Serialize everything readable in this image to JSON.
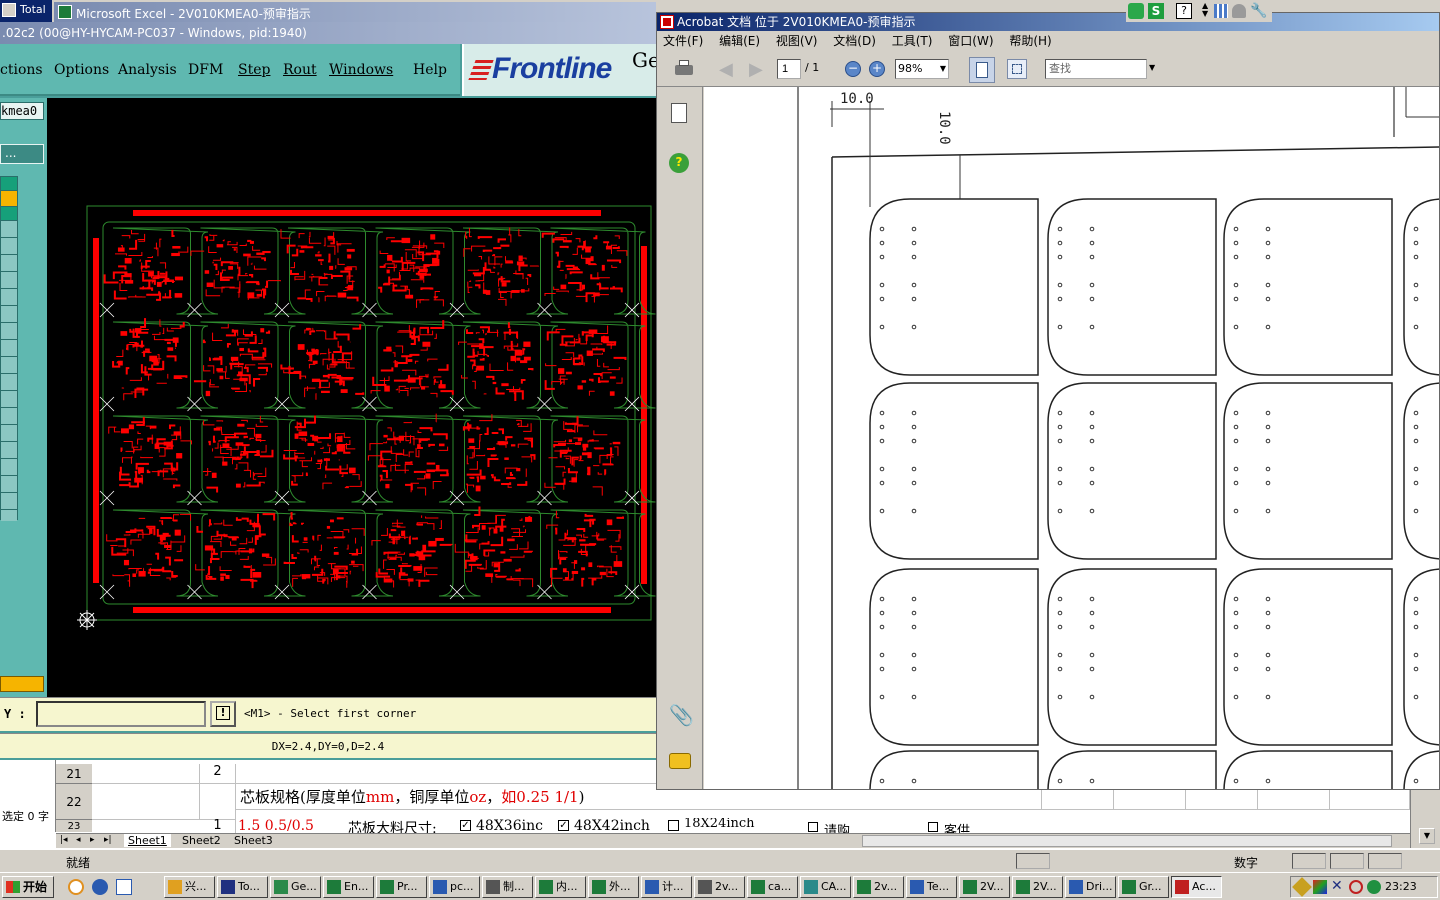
{
  "topbar": {
    "total_label": "Total",
    "excel_title": "Microsoft Excel - 2V010KMEA0-预审指示",
    "genesis_title": ".02c2 (00@HY-HYCAM-PC037 - Windows, pid:1940)"
  },
  "genesis": {
    "menu": [
      "ctions",
      "Options",
      "Analysis",
      "DFM",
      "Step",
      "Rout",
      "Windows",
      "Help"
    ],
    "brand": "Frontline",
    "brand_suffix": "Ge",
    "job_field": "kmea0",
    "dots_btn": "...",
    "y_label": "Y :",
    "y_input": "",
    "prompt_btn": "!",
    "prompt": "<M1> - Select first corner",
    "measure": "DX=2.4,DY=0,D=2.4"
  },
  "acrobat": {
    "title": "Acrobat 文档 位于 2V010KMEA0-预审指示",
    "menu": [
      "文件(F)",
      "编辑(E)",
      "视图(V)",
      "文档(D)",
      "工具(T)",
      "窗口(W)",
      "帮助(H)"
    ],
    "page_num": "1",
    "page_total": "/ 1",
    "zoom": "98%",
    "find_placeholder": "查找",
    "dim1": "10.0",
    "dim2": "10.0"
  },
  "excel": {
    "rows": [
      {
        "num": "21",
        "col_b": "2",
        "text": ""
      },
      {
        "num": "22",
        "col_b": "",
        "text": "芯板规格(厚度单位mm，铜厚单位oz，如0.25 1/1)"
      },
      {
        "num": "23",
        "col_b": "1",
        "text": "1.5 0.5/0.5"
      }
    ],
    "row22_red1": "mm",
    "row22_red2": "oz",
    "row22_red3": "如0.25 1/1",
    "row23_label": "芯板大料尺寸:",
    "opt1": "48X36inc",
    "opt2": "48X42inch",
    "opt3": "18X24inch",
    "opt4": "请购",
    "opt5": "客供",
    "selected_label": "选定 0 字",
    "sheets": [
      "Sheet1",
      "Sheet2",
      "Sheet3"
    ],
    "status_ready": "就绪",
    "status_num": "数字"
  },
  "taskbar": {
    "start": "开始",
    "tasks": [
      "兴...",
      "To...",
      "Ge...",
      "En...",
      "Pr...",
      "pc...",
      "制...",
      "内...",
      "外...",
      "计...",
      "2v...",
      "ca...",
      "CA...",
      "2v...",
      "Te...",
      "2V...",
      "2V...",
      "Dri...",
      "Gr...",
      "Ac..."
    ],
    "clock": "23:23"
  },
  "colors": {
    "genesis_teal": "#5fb8b0",
    "copper_red": "#ff0000",
    "outline_green": "#2e8b2e"
  }
}
